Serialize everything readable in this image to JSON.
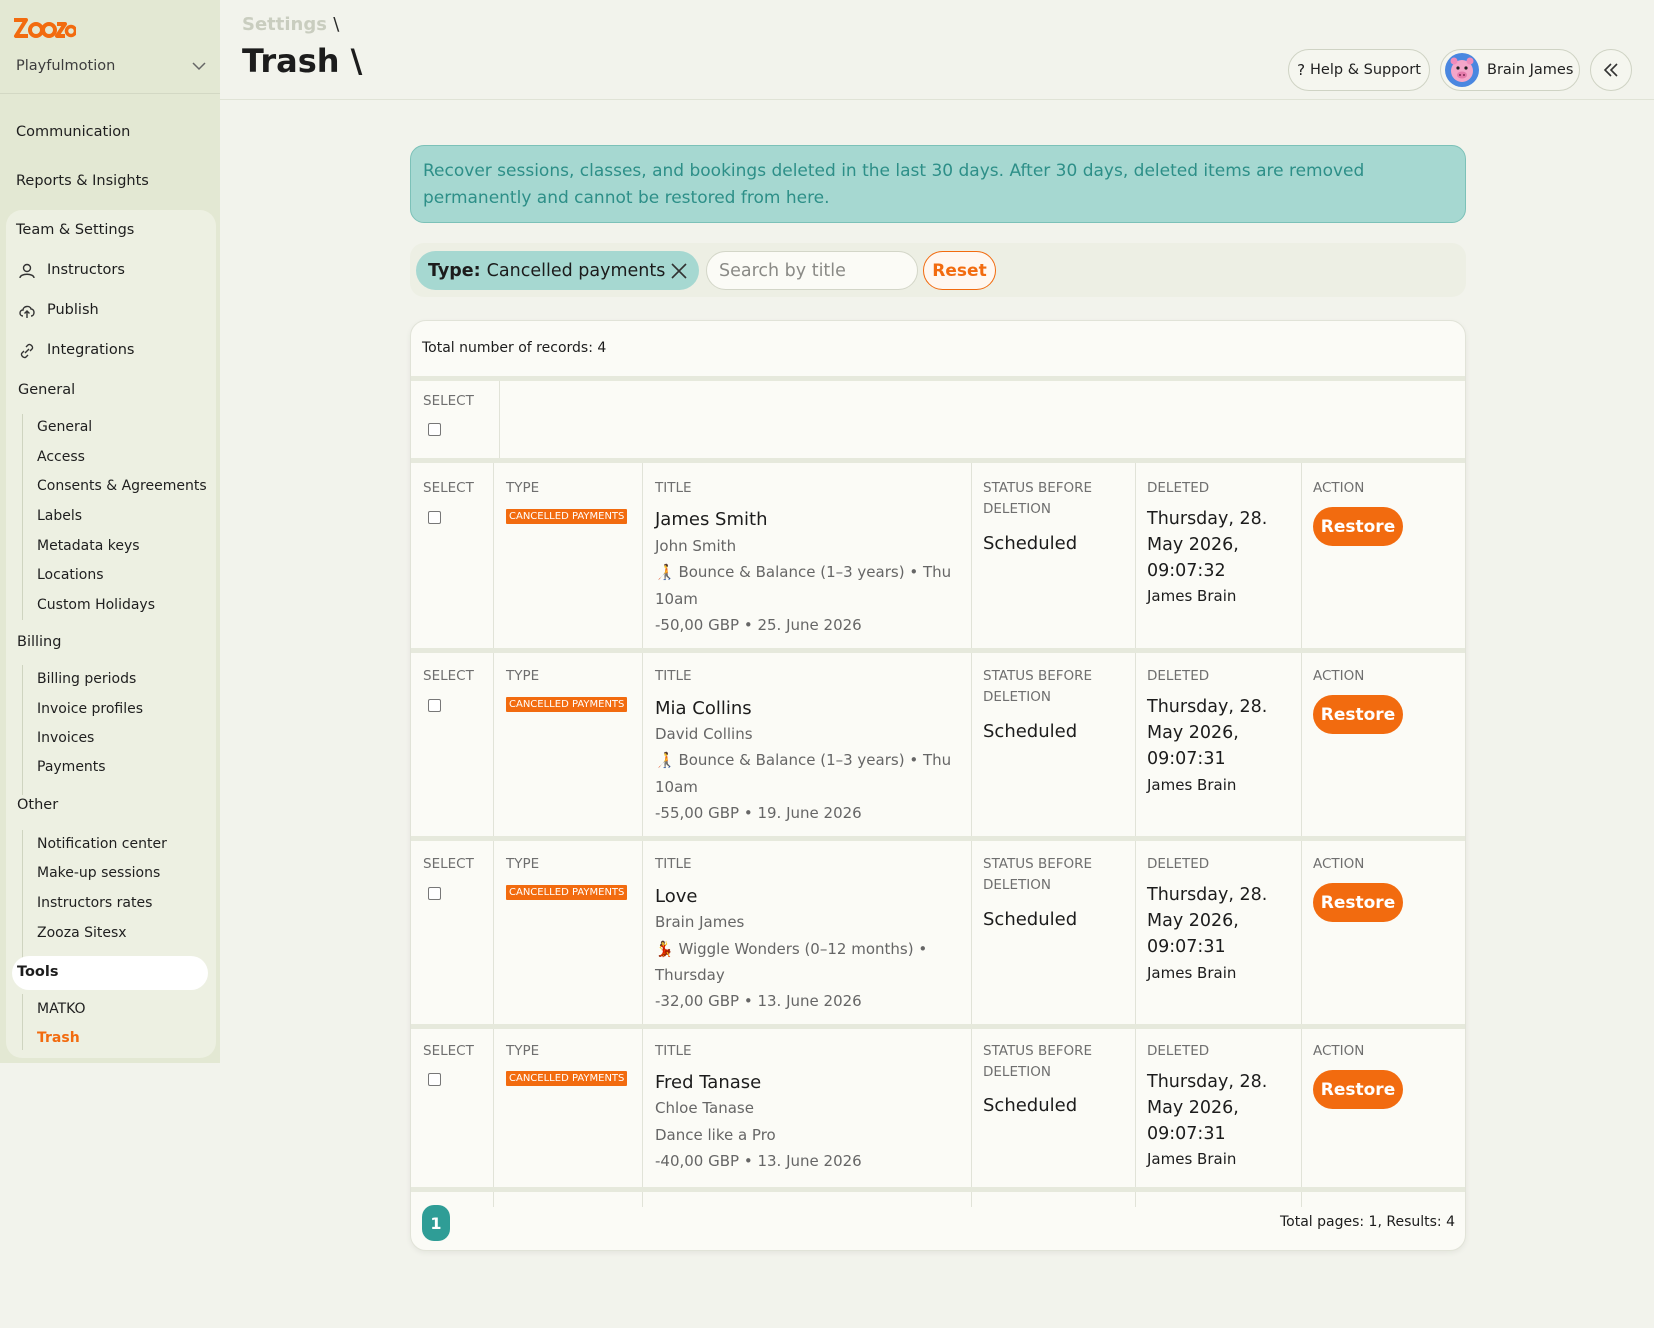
{
  "sidebar": {
    "org_name": "Playfulmotion",
    "top_items": [
      "Communication",
      "Reports & Insights"
    ],
    "team_settings_label": "Team & Settings",
    "nav_items": [
      {
        "label": "Instructors",
        "icon": "user-icon"
      },
      {
        "label": "Publish",
        "icon": "cloud-upload-icon"
      },
      {
        "label": "Integrations",
        "icon": "link-icon"
      }
    ],
    "groups": {
      "general": {
        "label": "General",
        "items": [
          "General",
          "Access",
          "Consents & Agreements",
          "Labels",
          "Metadata keys",
          "Locations",
          "Custom Holidays"
        ]
      },
      "billing": {
        "label": "Billing",
        "items": [
          "Billing periods",
          "Invoice profiles",
          "Invoices",
          "Payments"
        ]
      },
      "other": {
        "label": "Other",
        "items": [
          "Notification center",
          "Make-up sessions",
          "Instructors rates",
          "Zooza Sitesx"
        ]
      },
      "tools": {
        "label": "Tools",
        "items": [
          "MATKO",
          "Trash"
        ]
      }
    }
  },
  "header": {
    "breadcrumb": "Settings",
    "slash": "\\",
    "title": "Trash \\",
    "help_label": "Help & Support",
    "user_name": "Brain James"
  },
  "banner": {
    "text": "Recover sessions, classes, and bookings deleted in the last 30 days. After 30 days, deleted items are removed permanently and cannot be restored from here."
  },
  "filters": {
    "chip_key": "Type:",
    "chip_value": "Cancelled payments",
    "search_placeholder": "Search by title",
    "reset_label": "Reset"
  },
  "table": {
    "total_label": "Total number of records: 4",
    "labels": {
      "select": "SELECT",
      "type": "TYPE",
      "title": "TITLE",
      "status_line1": "STATUS BEFORE",
      "status_line2": "DELETION",
      "deleted": "DELETED",
      "action": "ACTION"
    },
    "restore_label": "Restore",
    "rows": [
      {
        "type": "CANCELLED PAYMENTS",
        "title": "James Smith",
        "parent": "John Smith",
        "course_line1": "🧑‍🦯 Bounce & Balance (1–3 years) • Thu",
        "course_line2": "10am",
        "amount": "-50,00 GBP • 25. June 2026",
        "status": "Scheduled",
        "deleted_line1": "Thursday, 28.",
        "deleted_line2": "May 2026,",
        "deleted_line3": "09:07:32",
        "deleted_by": "James Brain"
      },
      {
        "type": "CANCELLED PAYMENTS",
        "title": "Mia Collins",
        "parent": "David Collins",
        "course_line1": "🧑‍🦯 Bounce & Balance (1–3 years) • Thu",
        "course_line2": "10am",
        "amount": "-55,00 GBP • 19. June 2026",
        "status": "Scheduled",
        "deleted_line1": "Thursday, 28.",
        "deleted_line2": "May 2026,",
        "deleted_line3": "09:07:31",
        "deleted_by": "James Brain"
      },
      {
        "type": "CANCELLED PAYMENTS",
        "title": "Love",
        "parent": "Brain James",
        "course_line1": "💃 Wiggle Wonders (0–12 months) •",
        "course_line2": "Thursday",
        "amount": "-32,00 GBP • 13. June 2026",
        "status": "Scheduled",
        "deleted_line1": "Thursday, 28.",
        "deleted_line2": "May 2026,",
        "deleted_line3": "09:07:31",
        "deleted_by": "James Brain"
      },
      {
        "type": "CANCELLED PAYMENTS",
        "title": "Fred Tanase",
        "parent": "Chloe Tanase",
        "course_line1": "Dance like a Pro",
        "course_line2": "",
        "amount": "-40,00 GBP • 13. June 2026",
        "status": "Scheduled",
        "deleted_line1": "Thursday, 28.",
        "deleted_line2": "May 2026,",
        "deleted_line3": "09:07:31",
        "deleted_by": "James Brain"
      }
    ],
    "pagination": {
      "current_page": "1",
      "summary": "Total pages: 1, Results: 4"
    }
  },
  "colors": {
    "accent": "#f26b0f",
    "teal": "#2f9d96",
    "banner_bg": "#a6d8d1",
    "sidebar_bg": "#e3e8d3"
  }
}
